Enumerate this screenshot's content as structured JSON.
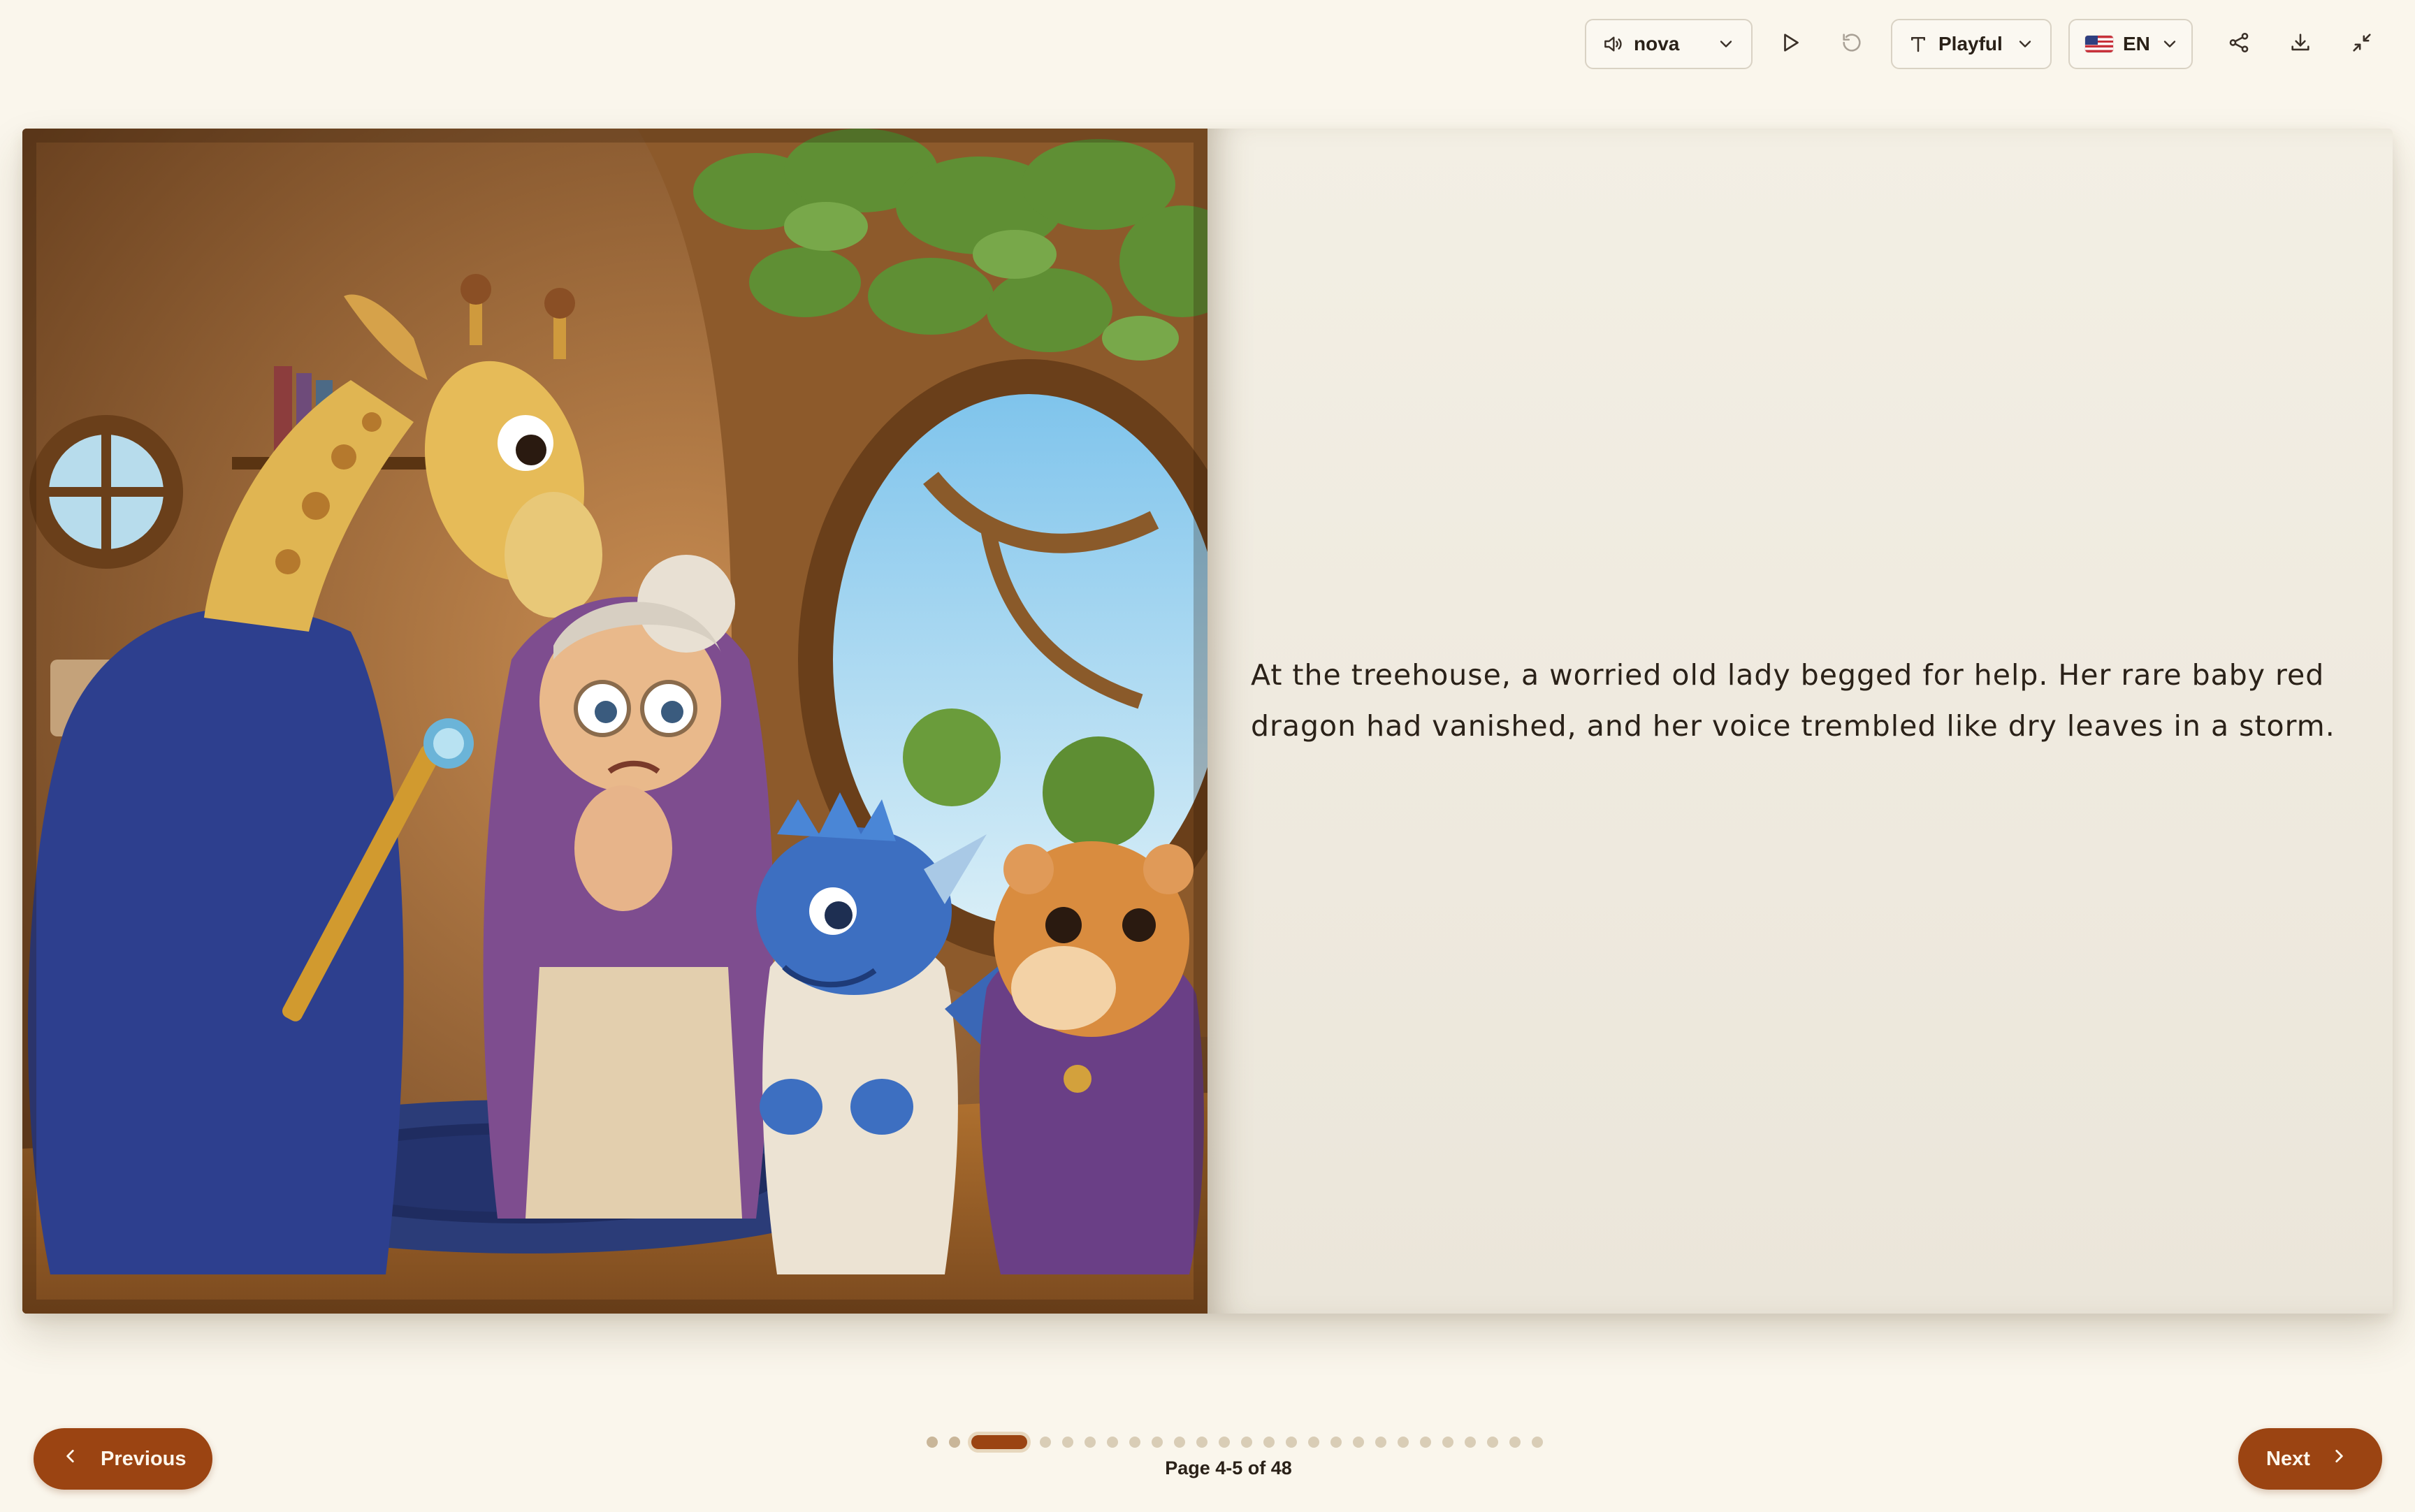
{
  "toolbar": {
    "voice": {
      "icon": "speaker-icon",
      "value": "nova"
    },
    "play": {
      "icon": "play-icon"
    },
    "reset": {
      "icon": "refresh-icon"
    },
    "font_style": {
      "icon": "text-type-icon",
      "value": "Playful"
    },
    "language": {
      "flag": "us-flag-icon",
      "value": "EN"
    },
    "share": {
      "icon": "share-icon"
    },
    "download": {
      "icon": "download-icon"
    },
    "exit_fullscreen": {
      "icon": "minimize-icon"
    }
  },
  "book": {
    "illustration": {
      "description_icon": "story-illustration",
      "characters": [
        "giraffe-wizard",
        "old-lady",
        "blue-dragon",
        "hamster"
      ]
    },
    "text": "At the treehouse, a worried old lady begged for help. Her rare baby red dragon had vanished, and her voice trembled like dry leaves in a storm."
  },
  "navigation": {
    "previous_label": "Previous",
    "next_label": "Next",
    "page_indicator": "Page 4-5 of 48",
    "dots_total": 26,
    "active_dot": 2
  },
  "colors": {
    "accent": "#9b4412",
    "background": "#faf6ec",
    "page": "#f1ede2"
  }
}
